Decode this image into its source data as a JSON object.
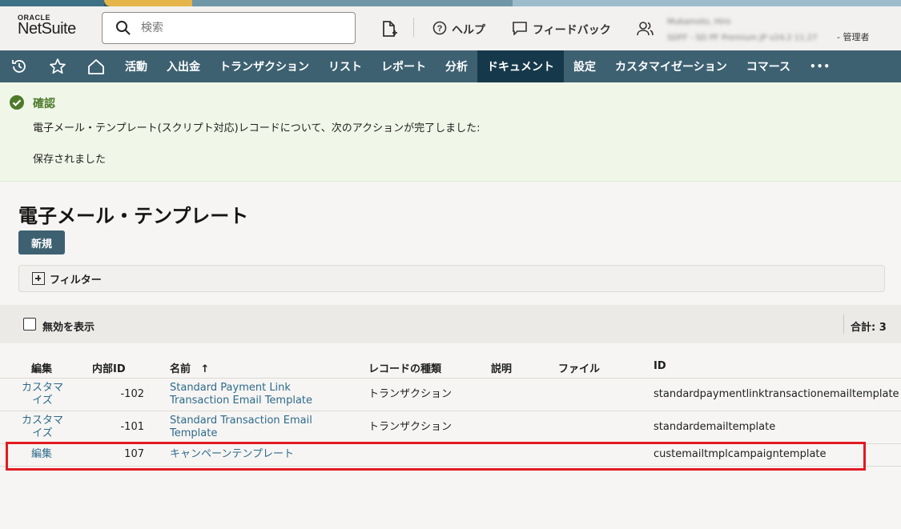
{
  "header": {
    "logo_top": "ORACLE",
    "logo_main": "NetSuite",
    "search_placeholder": "検索",
    "help_label": "ヘルプ",
    "feedback_label": "フィードバック",
    "user_name": "Mukamoto, Hiro",
    "user_account": "SDFF - SD PF Premium JP v24.2 11.27",
    "user_role": "- 管理者"
  },
  "nav": {
    "items": [
      "活動",
      "入出金",
      "トランザクション",
      "リスト",
      "レポート",
      "分析",
      "ドキュメント",
      "設定",
      "カスタマイゼーション",
      "コマース"
    ],
    "active_index": 6,
    "more": "•••"
  },
  "confirm": {
    "title": "確認",
    "message": "電子メール・テンプレート(スクリプト対応)レコードについて、次のアクションが完了しました:",
    "detail": "保存されました"
  },
  "page": {
    "title": "電子メール・テンプレート",
    "new_button": "新規",
    "filter_label": "フィルター",
    "show_inactive": "無効を表示",
    "total": "合計: 3"
  },
  "table": {
    "headers": [
      "編集",
      "内部ID",
      "名前",
      "レコードの種類",
      "説明",
      "ファイル",
      "ID"
    ],
    "sort_indicator": "↑",
    "rows": [
      {
        "edit": "カスタマイズ",
        "edit_l1": "カスタマ",
        "edit_l2": "イズ",
        "internal_id": "-102",
        "name_l1": "Standard Payment Link",
        "name_l2": "Transaction Email Template",
        "record_type": "トランザクション",
        "description": "",
        "file": "",
        "id": "standardpaymentlinktransactionemailtemplate"
      },
      {
        "edit": "カスタマイズ",
        "edit_l1": "カスタマ",
        "edit_l2": "イズ",
        "internal_id": "-101",
        "name_l1": "Standard Transaction Email",
        "name_l2": "Template",
        "record_type": "トランザクション",
        "description": "",
        "file": "",
        "id": "standardemailtemplate"
      },
      {
        "edit": "編集",
        "internal_id": "107",
        "name_l1": "キャンペーンテンプレート",
        "record_type": "",
        "description": "",
        "file": "",
        "id": "custemailtmplcampaigntemplate"
      }
    ]
  },
  "colors": {
    "nav_bg": "#3d6171",
    "nav_active": "#15394a",
    "link": "#2e6a8c",
    "success": "#4c7a2b",
    "highlight": "#e21a23"
  }
}
